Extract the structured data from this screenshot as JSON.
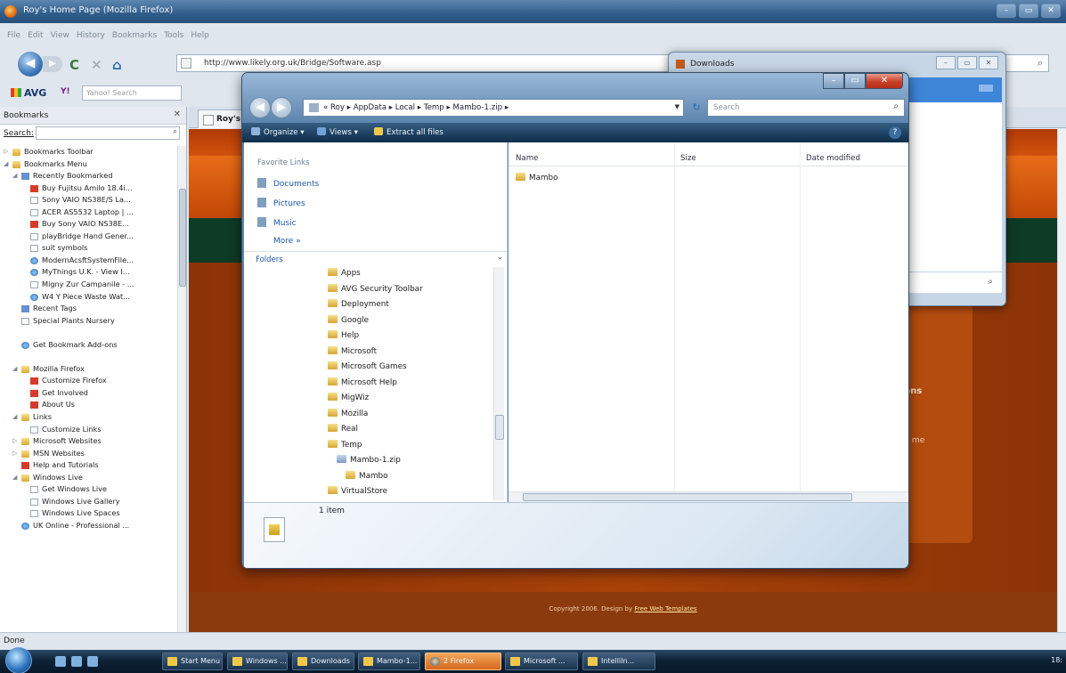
{
  "firefox": {
    "title": "Roy's Home Page (Mozilla Firefox)",
    "menu": [
      "File",
      "Edit",
      "View",
      "History",
      "Bookmarks",
      "Tools",
      "Help"
    ],
    "url": "http://www.likely.org.uk/Bridge/Software.asp",
    "avg_label": "AVG",
    "yahoo_label": "Y!",
    "search_placeholder": "Yahoo! Search",
    "status": "Done",
    "tab_label": "Roy's"
  },
  "sidebar": {
    "title": "Bookmarks",
    "search_label": "Search:",
    "items": [
      {
        "label": "Bookmarks Toolbar",
        "indent": 0,
        "icon": "folder",
        "expander": "▷"
      },
      {
        "label": "Bookmarks Menu",
        "indent": 0,
        "icon": "folder",
        "expander": "◢"
      },
      {
        "label": "Recently Bookmarked",
        "indent": 1,
        "icon": "star",
        "expander": "◢"
      },
      {
        "label": "Buy Fujitsu Amilo 18.4i...",
        "indent": 2,
        "icon": "red",
        "expander": ""
      },
      {
        "label": "Sony VAIO NS38E/S La...",
        "indent": 2,
        "icon": "page",
        "expander": ""
      },
      {
        "label": "ACER AS5532 Laptop | ...",
        "indent": 2,
        "icon": "page",
        "expander": ""
      },
      {
        "label": "Buy Sony VAIO NS38E...",
        "indent": 2,
        "icon": "red",
        "expander": ""
      },
      {
        "label": "playBridge Hand Gener...",
        "indent": 2,
        "icon": "page",
        "expander": ""
      },
      {
        "label": "suit symbols",
        "indent": 2,
        "icon": "page",
        "expander": ""
      },
      {
        "label": "ModernAcsftSystemFile...",
        "indent": 2,
        "icon": "globe",
        "expander": ""
      },
      {
        "label": "MyThings U.K. - View I...",
        "indent": 2,
        "icon": "globe",
        "expander": ""
      },
      {
        "label": "Migny Zur Campanile - ...",
        "indent": 2,
        "icon": "page",
        "expander": ""
      },
      {
        "label": "W4 Y Piece Waste Wat...",
        "indent": 2,
        "icon": "globe",
        "expander": ""
      },
      {
        "label": "Recent Tags",
        "indent": 1,
        "icon": "star",
        "expander": ""
      },
      {
        "label": "Special Plants Nursery",
        "indent": 1,
        "icon": "page",
        "expander": ""
      },
      {
        "label": "",
        "indent": 0,
        "icon": "",
        "expander": ""
      },
      {
        "label": "Get Bookmark Add-ons",
        "indent": 1,
        "icon": "globe",
        "expander": ""
      },
      {
        "label": "",
        "indent": 0,
        "icon": "",
        "expander": ""
      },
      {
        "label": "Mozilla Firefox",
        "indent": 1,
        "icon": "folder",
        "expander": "◢"
      },
      {
        "label": "Customize Firefox",
        "indent": 2,
        "icon": "red",
        "expander": ""
      },
      {
        "label": "Get Involved",
        "indent": 2,
        "icon": "red",
        "expander": ""
      },
      {
        "label": "About Us",
        "indent": 2,
        "icon": "red",
        "expander": ""
      },
      {
        "label": "Links",
        "indent": 1,
        "icon": "folder",
        "expander": "◢"
      },
      {
        "label": "Customize Links",
        "indent": 2,
        "icon": "page",
        "expander": ""
      },
      {
        "label": "Microsoft Websites",
        "indent": 1,
        "icon": "folder",
        "expander": "▷"
      },
      {
        "label": "MSN Websites",
        "indent": 1,
        "icon": "folder",
        "expander": "▷"
      },
      {
        "label": "Help and Tutorials",
        "indent": 1,
        "icon": "red",
        "expander": ""
      },
      {
        "label": "Windows Live",
        "indent": 1,
        "icon": "folder",
        "expander": "◢"
      },
      {
        "label": "Get Windows Live",
        "indent": 2,
        "icon": "page",
        "expander": ""
      },
      {
        "label": "Windows Live Gallery",
        "indent": 2,
        "icon": "page",
        "expander": ""
      },
      {
        "label": "Windows Live Spaces",
        "indent": 2,
        "icon": "page",
        "expander": ""
      },
      {
        "label": "UK Online - Professional ...",
        "indent": 1,
        "icon": "globe",
        "expander": ""
      }
    ]
  },
  "page": {
    "side_text_1": "ions",
    "side_text_2": "me",
    "copyright": "Copyright 2006. Design by ",
    "copyright_link": "Free Web Templates"
  },
  "downloads": {
    "title": "Downloads"
  },
  "explorer": {
    "path": "« Roy ▸ AppData ▸ Local ▸ Temp ▸ Mambo-1.zip ▸",
    "search_placeholder": "Search",
    "toolbar": {
      "organize": "Organize ▾",
      "views": "Views ▾",
      "extract": "Extract all files"
    },
    "favorite_links_title": "Favorite Links",
    "favorite_links": [
      "Documents",
      "Pictures",
      "Music"
    ],
    "more": "More »",
    "folders_title": "Folders",
    "tree": [
      {
        "label": "Apps",
        "indent": 0,
        "icon": "folder"
      },
      {
        "label": "AVG Security Toolbar",
        "indent": 0,
        "icon": "folder"
      },
      {
        "label": "Deployment",
        "indent": 0,
        "icon": "folder"
      },
      {
        "label": "Google",
        "indent": 0,
        "icon": "folder"
      },
      {
        "label": "Help",
        "indent": 0,
        "icon": "folder"
      },
      {
        "label": "Microsoft",
        "indent": 0,
        "icon": "folder"
      },
      {
        "label": "Microsoft Games",
        "indent": 0,
        "icon": "folder"
      },
      {
        "label": "Microsoft Help",
        "indent": 0,
        "icon": "folder"
      },
      {
        "label": "MigWiz",
        "indent": 0,
        "icon": "folder"
      },
      {
        "label": "Mozilla",
        "indent": 0,
        "icon": "folder"
      },
      {
        "label": "Real",
        "indent": 0,
        "icon": "folder"
      },
      {
        "label": "Temp",
        "indent": 0,
        "icon": "folder"
      },
      {
        "label": "Mambo-1.zip",
        "indent": 1,
        "icon": "zip"
      },
      {
        "label": "Mambo",
        "indent": 2,
        "icon": "folder"
      },
      {
        "label": "VirtualStore",
        "indent": 0,
        "icon": "folder"
      }
    ],
    "columns": {
      "name": "Name",
      "size": "Size",
      "date": "Date modified"
    },
    "files": [
      {
        "name": "Mambo",
        "size": "",
        "date": ""
      }
    ],
    "item_count": "1 item"
  },
  "taskbar": {
    "buttons": [
      {
        "label": "Start Menu",
        "active": false
      },
      {
        "label": "Windows ...",
        "active": false
      },
      {
        "label": "Downloads",
        "active": false
      },
      {
        "label": "Mambo-1...",
        "active": false
      },
      {
        "label": "2 Firefox",
        "active": true
      },
      {
        "label": "Microsoft ...",
        "active": false
      },
      {
        "label": "IntelliIn...",
        "active": false
      }
    ],
    "clock": "18:"
  }
}
